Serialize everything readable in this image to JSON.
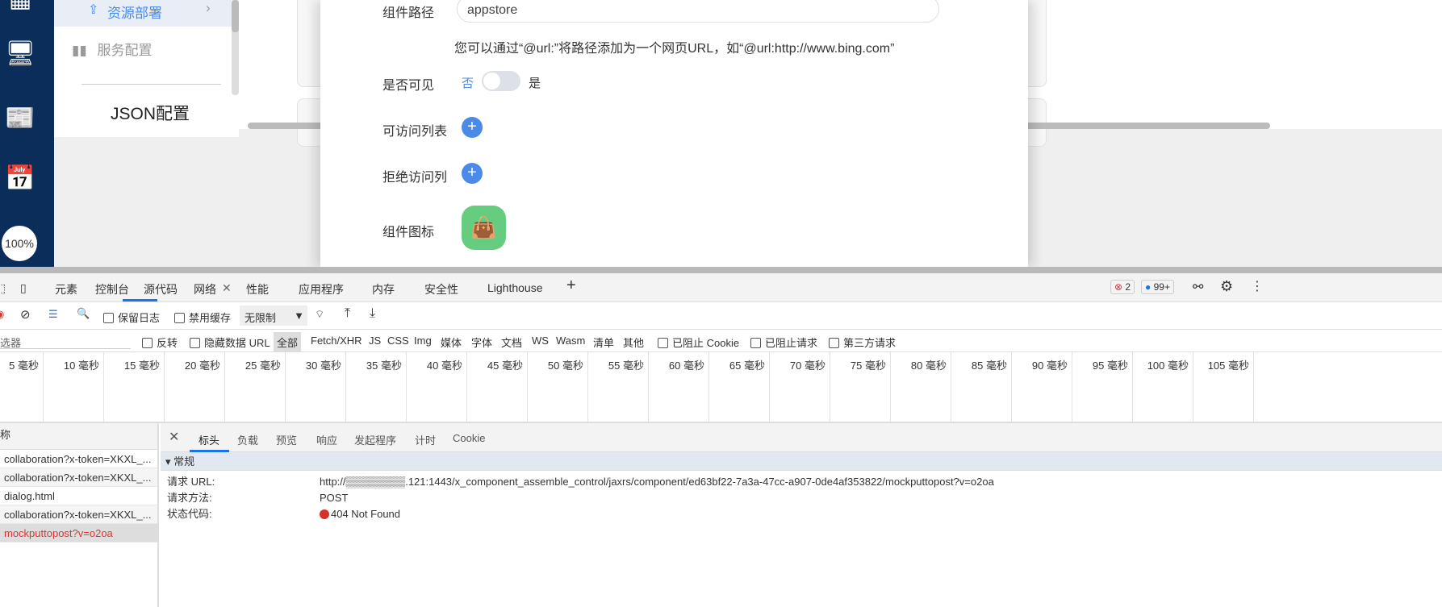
{
  "sidebar": {
    "zoom": "100%"
  },
  "menu": {
    "active": "资源部署",
    "service": "服务配置",
    "json": "JSON配置"
  },
  "form": {
    "path_label": "组件路径",
    "path_value": "appstore",
    "hint": "您可以通过“@url:”将路径添加为一个网页URL，如“@url:http://www.bing.com”",
    "visible_label": "是否可见",
    "visible_no": "否",
    "visible_yes": "是",
    "visible": false,
    "allow_label": "可访问列表",
    "deny_label": "拒绝访问列",
    "icon_label": "组件图标",
    "icon_color": "#66cc80"
  },
  "devtools": {
    "tabs": [
      "元素",
      "控制台",
      "源代码",
      "网络",
      "性能",
      "应用程序",
      "内存",
      "安全性",
      "Lighthouse"
    ],
    "active_tab": "网络",
    "errors": "2",
    "messages": "99+",
    "toolbar": {
      "preserve_log": "保留日志",
      "disable_cache": "禁用缓存",
      "throttle": "无限制"
    },
    "filter": {
      "placeholder": "选器",
      "invert": "反转",
      "hide_data_url": "隐藏数据 URL",
      "types": [
        "全部",
        "Fetch/XHR",
        "JS",
        "CSS",
        "Img",
        "媒体",
        "字体",
        "文档",
        "WS",
        "Wasm",
        "清单",
        "其他"
      ],
      "blocked_cookies": "已阻止 Cookie",
      "blocked_requests": "已阻止请求",
      "third_party": "第三方请求"
    },
    "timeline": [
      "5 毫秒",
      "10 毫秒",
      "15 毫秒",
      "20 毫秒",
      "25 毫秒",
      "30 毫秒",
      "35 毫秒",
      "40 毫秒",
      "45 毫秒",
      "50 毫秒",
      "55 毫秒",
      "60 毫秒",
      "65 毫秒",
      "70 毫秒",
      "75 毫秒",
      "80 毫秒",
      "85 毫秒",
      "90 毫秒",
      "95 毫秒",
      "100 毫秒",
      "105 毫秒"
    ],
    "list_header": "称",
    "requests": [
      "collaboration?x-token=XKXL_...",
      "collaboration?x-token=XKXL_...",
      "dialog.html",
      "collaboration?x-token=XKXL_...",
      "mockputtopost?v=o2oa"
    ],
    "detail_tabs": [
      "标头",
      "负载",
      "预览",
      "响应",
      "发起程序",
      "计时",
      "Cookie"
    ],
    "section": "常规",
    "rows": [
      {
        "k": "请求 URL:",
        "v": "http://▒▒▒▒▒▒▒▒.121:1443/x_component_assemble_control/jaxrs/component/ed63bf22-7a3a-47cc-a907-0de4af353822/mockputtopost?v=o2oa"
      },
      {
        "k": "请求方法:",
        "v": "POST"
      },
      {
        "k": "状态代码:",
        "v": "404 Not Found"
      }
    ]
  }
}
